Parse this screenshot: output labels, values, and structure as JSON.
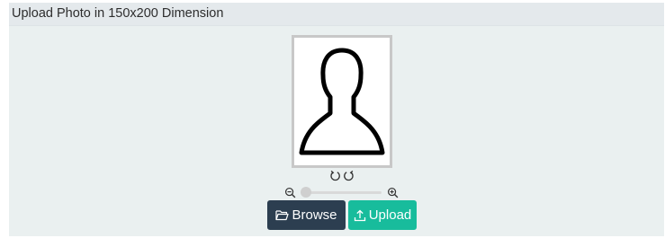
{
  "panel": {
    "title": "Upload Photo in 150x200 Dimension"
  },
  "photo": {
    "placeholder_icon": "person-silhouette-icon"
  },
  "controls": {
    "rotate_left_icon": "rotate-left-icon",
    "rotate_right_icon": "rotate-right-icon",
    "zoom_out_icon": "zoom-out-icon",
    "zoom_in_icon": "zoom-in-icon",
    "zoom_level": 0
  },
  "buttons": {
    "browse_label": "Browse",
    "browse_icon": "folder-open-icon",
    "upload_label": "Upload",
    "upload_icon": "upload-icon"
  },
  "colors": {
    "panel_background": "#eaf0f0",
    "browse_button": "#2c3e50",
    "upload_button": "#18bc9c"
  }
}
